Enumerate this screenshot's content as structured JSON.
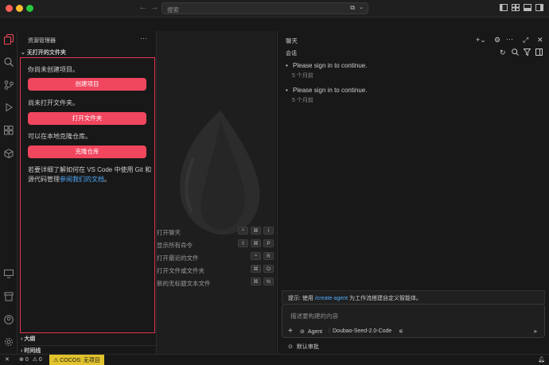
{
  "titlebar": {
    "colors": {
      "close": "#ff5f57",
      "minimize": "#febc2e",
      "zoom": "#28c840"
    },
    "back": "←",
    "forward": "→",
    "search_placeholder": "搜索"
  },
  "sidebar": {
    "title": "资源管理器",
    "more": "···",
    "section": "无打开的文件夹",
    "no_project_text": "你尚未创建项目。",
    "create_project_button": "创建项目",
    "no_folder_text": "尚未打开文件夹。",
    "open_folder_button": "打开文件夹",
    "clone_text": "可以在本地克隆仓库。",
    "clone_button": "克隆仓库",
    "learn_more_line1": "若要详细了解如何在 VS Code 中使用 Git 和",
    "learn_more_line2_prefix": "源代码管理",
    "learn_more_link": "参阅我们的文档",
    "learn_more_suffix": "。",
    "outline": "大纲",
    "timeline": "时间线"
  },
  "editor": {
    "commands": [
      {
        "label": "打开聊天",
        "keys": [
          "^",
          "⌘",
          "I"
        ]
      },
      {
        "label": "显示所有命令",
        "keys": [
          "⇧",
          "⌘",
          "P"
        ]
      },
      {
        "label": "打开最近的文件",
        "keys": [
          "^",
          "R"
        ]
      },
      {
        "label": "打开文件或文件夹",
        "keys": [
          "⌘",
          "O"
        ]
      },
      {
        "label": "新的无标题文本文件",
        "keys": [
          "⌘",
          "N"
        ]
      }
    ]
  },
  "chat": {
    "title": "聊天",
    "section": "会话",
    "messages": [
      {
        "text": "Please sign in to continue.",
        "time": "5 个月前"
      },
      {
        "text": "Please sign in to continue.",
        "time": "5 个月前"
      }
    ],
    "tip_prefix": "提示: 使用 ",
    "tip_command": "/create-agent",
    "tip_suffix": " 为工作流搭建自定义智能体。",
    "input_placeholder": "描述要构建的内容",
    "mode": "Agent",
    "model": "Doubao-Seed-2.0-Code",
    "review": "默认审批"
  },
  "status": {
    "errors": "0",
    "warnings": "0",
    "cocos": "COCOS: 无项目"
  }
}
